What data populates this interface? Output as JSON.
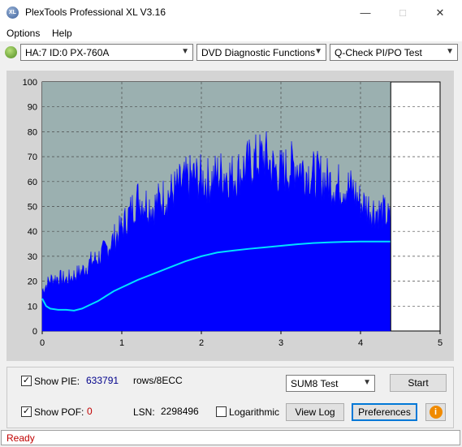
{
  "window": {
    "title": "PlexTools Professional XL V3.16",
    "icon_text": "XL"
  },
  "menu": {
    "items": [
      "Options",
      "Help"
    ]
  },
  "toolbar": {
    "drive": "HA:7 ID:0  PX-760A",
    "function": "DVD Diagnostic Functions",
    "test": "Q-Check PI/PO Test"
  },
  "chart_data": {
    "type": "area",
    "xlabel": "",
    "ylabel": "",
    "xlim": [
      0,
      5
    ],
    "ylim": [
      0,
      100
    ],
    "x_ticks": [
      "0",
      "1",
      "2",
      "3",
      "4",
      "5"
    ],
    "y_ticks": [
      "0",
      "10",
      "20",
      "30",
      "40",
      "50",
      "60",
      "70",
      "80",
      "90",
      "100"
    ],
    "grid": true,
    "scan_end_gb": 4.38,
    "series": [
      {
        "color": "#0000ff",
        "x": [
          0,
          0.1,
          0.2,
          0.3,
          0.4,
          0.5,
          0.6,
          0.7,
          0.8,
          0.9,
          1.0,
          1.1,
          1.2,
          1.3,
          1.4,
          1.5,
          1.6,
          1.7,
          1.8,
          1.9,
          2.0,
          2.1,
          2.2,
          2.3,
          2.4,
          2.5,
          2.6,
          2.7,
          2.8,
          2.9,
          3.0,
          3.1,
          3.2,
          3.3,
          3.4,
          3.5,
          3.6,
          3.7,
          3.8,
          3.9,
          4.0,
          4.1,
          4.2,
          4.3,
          4.38
        ],
        "values": [
          19,
          24,
          25,
          24,
          26,
          28,
          32,
          34,
          38,
          43,
          48,
          55,
          62,
          60,
          58,
          62,
          64,
          67,
          70,
          72,
          71,
          70,
          73,
          74,
          72,
          75,
          78,
          80,
          82,
          76,
          74,
          76,
          78,
          75,
          73,
          72,
          70,
          68,
          68,
          66,
          60,
          58,
          56,
          55,
          51
        ]
      },
      {
        "color": "#00e0ff",
        "x": [
          0,
          0.05,
          0.1,
          0.2,
          0.3,
          0.4,
          0.5,
          0.6,
          0.7,
          0.8,
          0.9,
          1.0,
          1.1,
          1.2,
          1.4,
          1.6,
          1.8,
          2.0,
          2.2,
          2.4,
          2.6,
          2.8,
          3.0,
          3.2,
          3.4,
          3.6,
          3.8,
          4.0,
          4.2,
          4.38
        ],
        "values": [
          13,
          10,
          9,
          8.5,
          8.5,
          8.2,
          9,
          10.5,
          12,
          14,
          16,
          17.5,
          19,
          20.5,
          23,
          25.5,
          28,
          30,
          31.5,
          32.3,
          33,
          33.6,
          34.2,
          34.8,
          35.3,
          35.6,
          35.8,
          35.9,
          35.9,
          35.9
        ]
      }
    ]
  },
  "panel": {
    "show_pie_label": "Show PIE:",
    "pie_value": "633791",
    "rows_label": "rows/8ECC",
    "show_pof_label": "Show POF:",
    "pof_value": "0",
    "lsn_label": "LSN:",
    "lsn_value": "2298496",
    "log_label": "Logarithmic",
    "sum_select": "SUM8 Test",
    "start_label": "Start",
    "viewlog_label": "View Log",
    "prefs_label": "Preferences",
    "info_icon": "info-icon"
  },
  "status": {
    "text": "Ready"
  },
  "colors": {
    "pie_value": "#00008b",
    "pof_value": "#c00000",
    "status": "#c00000",
    "plot_bg": "#9bb0b0",
    "pie_area": "#0000ff",
    "pif_line": "#00e0ff"
  }
}
